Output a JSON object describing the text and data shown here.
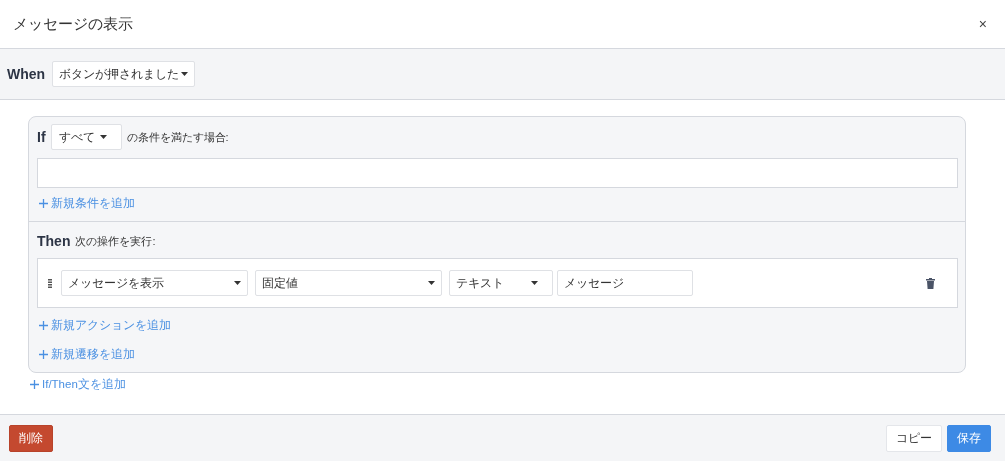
{
  "dialog": {
    "title": "メッセージの表示",
    "close": "×"
  },
  "when": {
    "label": "When",
    "trigger": "ボタンが押されました"
  },
  "blocks": [
    {
      "if": {
        "label": "If",
        "match": "すべて",
        "suffix": "の条件を満たす場合:",
        "add_condition": "新規条件を追加"
      },
      "then": {
        "label": "Then",
        "suffix": "次の操作を実行:",
        "actions": [
          {
            "fields": [
              {
                "kind": "dropdown",
                "value": "メッセージを表示"
              },
              {
                "kind": "dropdown",
                "value": "固定値"
              },
              {
                "kind": "dropdown",
                "value": "テキスト"
              },
              {
                "kind": "text",
                "value": "メッセージ"
              }
            ]
          }
        ],
        "add_action": "新規アクションを追加",
        "add_transition": "新規遷移を追加"
      }
    }
  ],
  "add_block": "If/Then文を追加",
  "footer": {
    "delete": "削除",
    "copy": "コピー",
    "save": "保存"
  }
}
